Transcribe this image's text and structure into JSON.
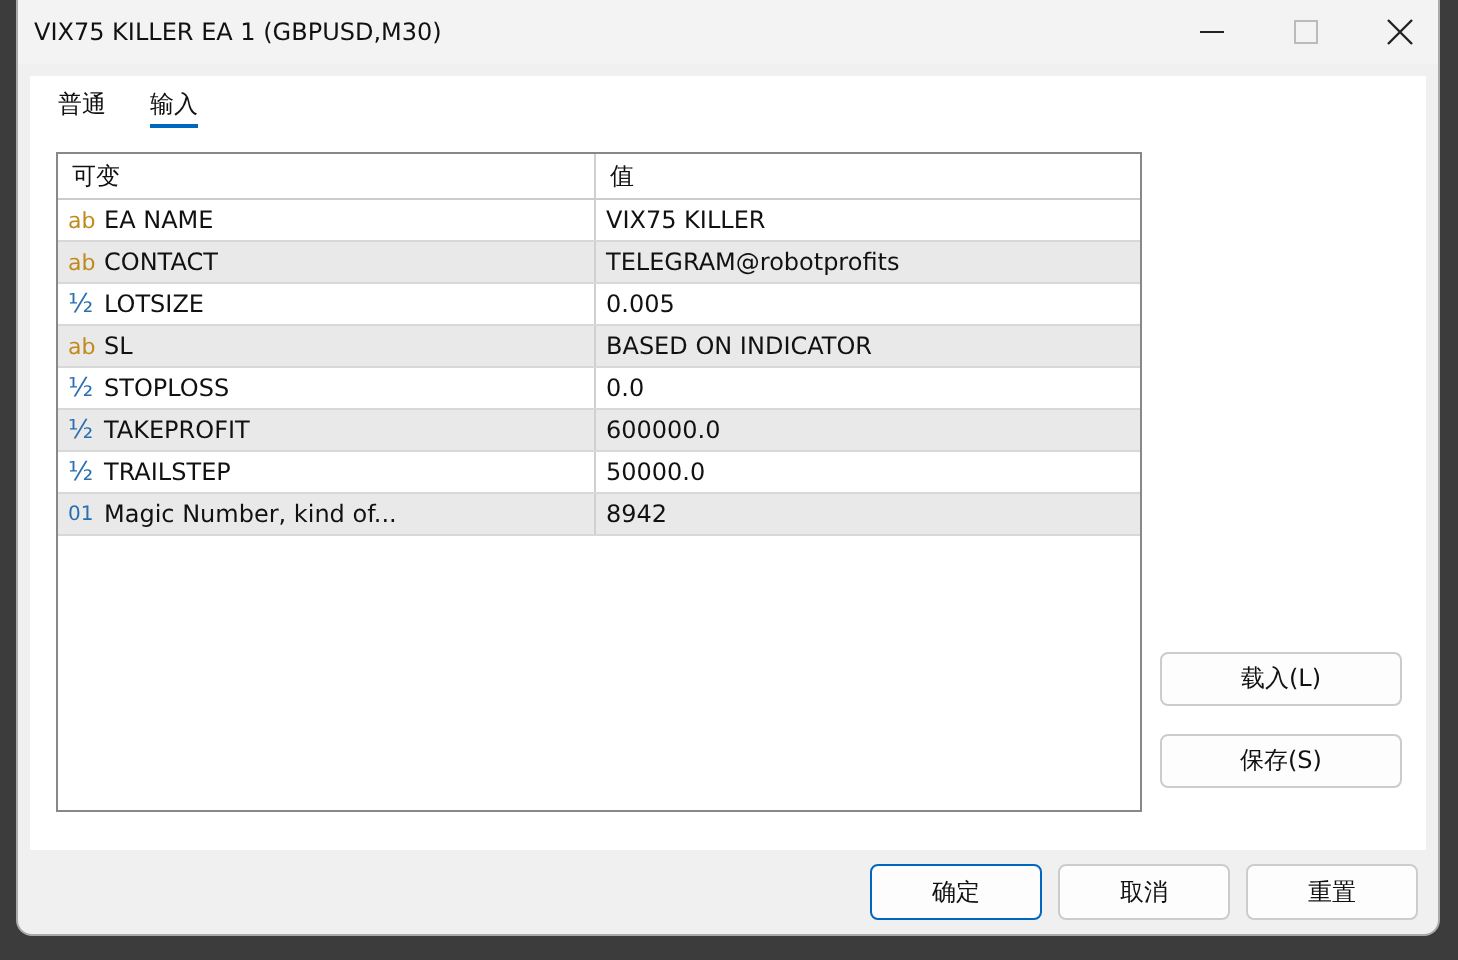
{
  "window": {
    "title": "VIX75 KILLER EA 1 (GBPUSD,M30)"
  },
  "tabs": [
    {
      "label": "普通",
      "selected": false
    },
    {
      "label": "输入",
      "selected": true
    }
  ],
  "table": {
    "columns": [
      "可变",
      "值"
    ],
    "rows": [
      {
        "kind": "string",
        "type_icon": "ab",
        "name": "EA NAME",
        "value": "VIX75 KILLER"
      },
      {
        "kind": "string",
        "type_icon": "ab",
        "name": "CONTACT",
        "value": "TELEGRAM@robotprofits"
      },
      {
        "kind": "double",
        "type_icon": "½",
        "name": "LOTSIZE",
        "value": "0.005"
      },
      {
        "kind": "string",
        "type_icon": "ab",
        "name": "SL",
        "value": "BASED ON INDICATOR"
      },
      {
        "kind": "double",
        "type_icon": "½",
        "name": "STOPLOSS",
        "value": "0.0"
      },
      {
        "kind": "double",
        "type_icon": "½",
        "name": "TAKEPROFIT",
        "value": "600000.0"
      },
      {
        "kind": "double",
        "type_icon": "½",
        "name": "TRAILSTEP",
        "value": "50000.0"
      },
      {
        "kind": "int",
        "type_icon": "01",
        "name": "Magic Number, kind of...",
        "value": "8942"
      }
    ]
  },
  "side_buttons": [
    "载入(L)",
    "保存(S)"
  ],
  "buttons": [
    {
      "label": "确定",
      "default": true
    },
    {
      "label": "取消",
      "default": false
    },
    {
      "label": "重置",
      "default": false
    }
  ]
}
